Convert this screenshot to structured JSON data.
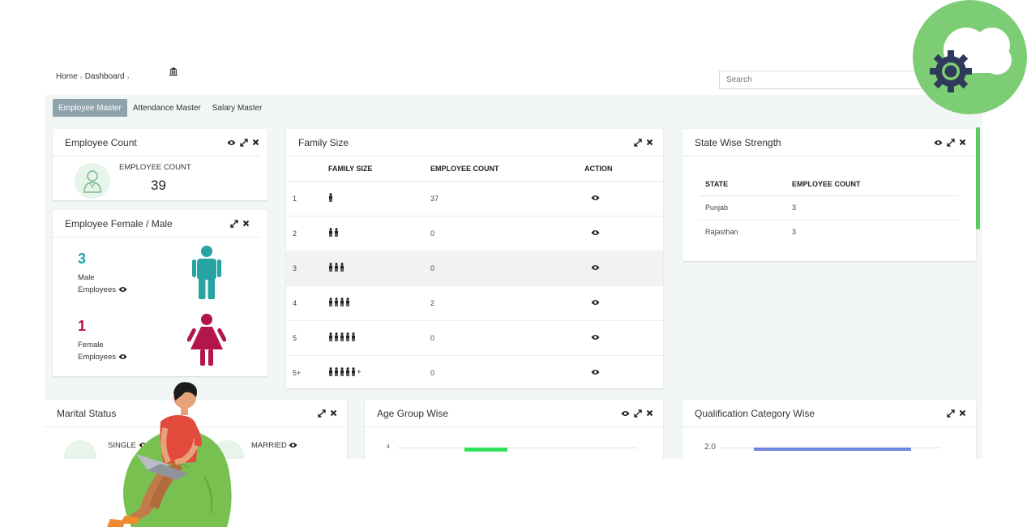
{
  "breadcrumb": {
    "home": "Home",
    "sep1": "›",
    "dashboard": "Dashboard",
    "sep2": "›"
  },
  "search": {
    "placeholder": "Search"
  },
  "tabs": [
    {
      "label": "Employee Master",
      "active": true
    },
    {
      "label": "Attendance Master",
      "active": false
    },
    {
      "label": "Salary Master",
      "active": false
    }
  ],
  "employee_count": {
    "title": "Employee Count",
    "caption": "EMPLOYEE COUNT",
    "value": "39"
  },
  "gender": {
    "title": "Employee Female / Male",
    "male_value": "3",
    "male_label_1": "Male",
    "male_label_2": "Employees",
    "female_value": "1",
    "female_label_1": "Female",
    "female_label_2": "Employees"
  },
  "family": {
    "title": "Family Size",
    "headers": [
      "FAMILY SIZE",
      "EMPLOYEE COUNT",
      "ACTION"
    ],
    "rows": [
      {
        "size": "1",
        "icons": 1,
        "plus": "",
        "count": "37"
      },
      {
        "size": "2",
        "icons": 2,
        "plus": "",
        "count": "0"
      },
      {
        "size": "3",
        "icons": 3,
        "plus": "",
        "count": "0"
      },
      {
        "size": "4",
        "icons": 4,
        "plus": "",
        "count": "2"
      },
      {
        "size": "5",
        "icons": 5,
        "plus": "",
        "count": "0"
      },
      {
        "size": "5+",
        "icons": 5,
        "plus": "+",
        "count": "0"
      }
    ]
  },
  "state": {
    "title": "State Wise Strength",
    "headers": [
      "STATE",
      "EMPLOYEE COUNT"
    ],
    "rows": [
      {
        "state": "Punjab",
        "count": "3"
      },
      {
        "state": "Rajasthan",
        "count": "3"
      }
    ]
  },
  "marital": {
    "title": "Marital Status",
    "single": "SINGLE",
    "married": "MARRIED"
  },
  "age": {
    "title": "Age Group Wise",
    "tick": "4"
  },
  "qualification": {
    "title": "Qualification Category Wise",
    "tick": "2.0"
  },
  "colors": {
    "accent_male": "#26a3a3",
    "accent_female": "#b3164a",
    "active_tab": "#8fa3ad",
    "badge_green": "#7ccd74",
    "age_bar": "#2ee05a",
    "qual_bar": "#6f86e0",
    "scroll_green": "#5cc95c"
  }
}
